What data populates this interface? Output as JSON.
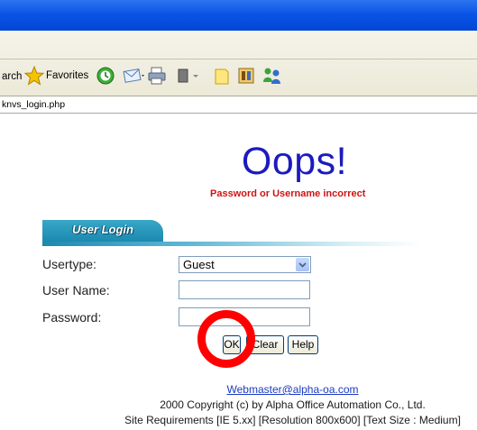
{
  "toolbar": {
    "search_label": "arch",
    "favorites_label": "Favorites"
  },
  "address": {
    "value": "knvs_login.php"
  },
  "page": {
    "heading": "Oops!",
    "error_message": "Password or Username incorrect"
  },
  "login": {
    "tab_label": "User Login",
    "usertype_label": "Usertype:",
    "usertype_value": "Guest",
    "username_label": "User Name:",
    "username_value": "",
    "password_label": "Password:",
    "password_value": ""
  },
  "buttons": {
    "ok": "OK",
    "clear": "Clear",
    "help": "Help"
  },
  "footer": {
    "email": "Webmaster@alpha-oa.com",
    "copyright": "2000 Copyright (c) by Alpha Office Automation Co., Ltd.",
    "requirements": "Site Requirements [IE 5.xx] [Resolution 800x600] [Text Size : Medium]"
  },
  "colors": {
    "titlebar": "#0a55e6",
    "heading": "#1b1bbf",
    "error": "#d01313",
    "tab": "#1c89b0",
    "highlight": "#ff0000"
  },
  "icons": [
    "star-icon",
    "history-icon",
    "mail-icon",
    "print-icon",
    "edit-icon",
    "folder-icon",
    "media-icon",
    "messenger-icon"
  ]
}
